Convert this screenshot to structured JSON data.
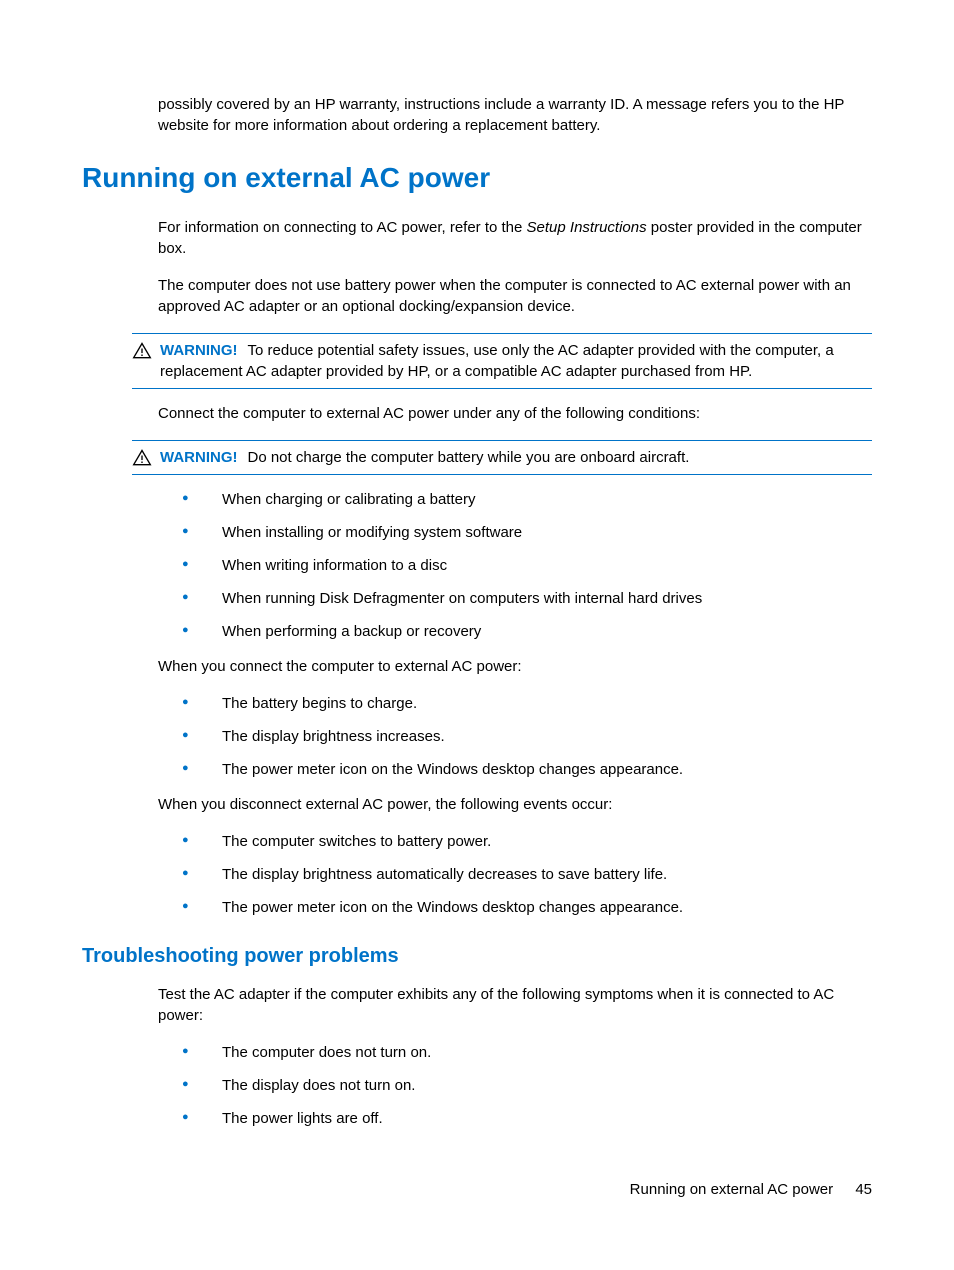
{
  "intro_fragment": "possibly covered by an HP warranty, instructions include a warranty ID. A message refers you to the HP website for more information about ordering a replacement battery.",
  "section1": {
    "heading": "Running on external AC power",
    "para1_pre": "For information on connecting to AC power, refer to the ",
    "para1_italic": "Setup Instructions",
    "para1_post": " poster provided in the computer box.",
    "para2": "The computer does not use battery power when the computer is connected to AC external power with an approved AC adapter or an optional docking/expansion device.",
    "warning1_label": "WARNING!",
    "warning1_text": "To reduce potential safety issues, use only the AC adapter provided with the computer, a replacement AC adapter provided by HP, or a compatible AC adapter purchased from HP.",
    "para3": "Connect the computer to external AC power under any of the following conditions:",
    "warning2_label": "WARNING!",
    "warning2_text": "Do not charge the computer battery while you are onboard aircraft.",
    "list1": [
      "When charging or calibrating a battery",
      "When installing or modifying system software",
      "When writing information to a disc",
      "When running Disk Defragmenter on computers with internal hard drives",
      "When performing a backup or recovery"
    ],
    "para4": "When you connect the computer to external AC power:",
    "list2": [
      "The battery begins to charge.",
      "The display brightness increases.",
      "The power meter icon on the Windows desktop changes appearance."
    ],
    "para5": "When you disconnect external AC power, the following events occur:",
    "list3": [
      "The computer switches to battery power.",
      "The display brightness automatically decreases to save battery life.",
      "The power meter icon on the Windows desktop changes appearance."
    ]
  },
  "section2": {
    "heading": "Troubleshooting power problems",
    "para1": "Test the AC adapter if the computer exhibits any of the following symptoms when it is connected to AC power:",
    "list1": [
      "The computer does not turn on.",
      "The display does not turn on.",
      "The power lights are off."
    ]
  },
  "footer": {
    "title": "Running on external AC power",
    "page": "45"
  }
}
